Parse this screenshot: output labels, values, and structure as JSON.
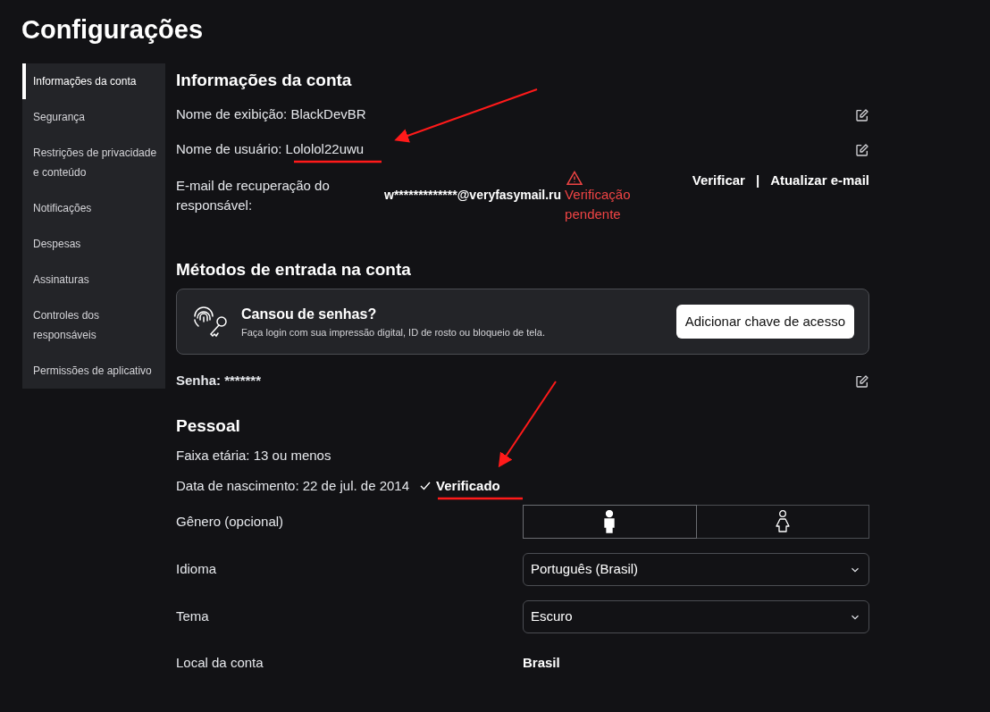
{
  "page_title": "Configurações",
  "sidebar": {
    "items": [
      {
        "label": "Informações da conta",
        "selected": true
      },
      {
        "label": "Segurança",
        "selected": false
      },
      {
        "label": "Restrições de privacidade e conteúdo",
        "selected": false
      },
      {
        "label": "Notificações",
        "selected": false
      },
      {
        "label": "Despesas",
        "selected": false
      },
      {
        "label": "Assinaturas",
        "selected": false
      },
      {
        "label": "Controles dos responsáveis",
        "selected": false
      },
      {
        "label": "Permissões de aplicativo",
        "selected": false
      }
    ]
  },
  "account_info": {
    "heading": "Informações da conta",
    "display_name": {
      "label": "Nome de exibição:",
      "value": "BlackDevBR"
    },
    "username": {
      "label": "Nome de usuário:",
      "value": "Lololol22uwu"
    },
    "recovery_email": {
      "label": "E-mail de recuperação do responsável:",
      "value": "w*************@veryfasymail.ru",
      "status": "Verificação pendente",
      "actions": [
        "Verificar",
        "Atualizar e-mail"
      ],
      "separator": "|"
    }
  },
  "sign_in_methods": {
    "heading": "Métodos de entrada na conta",
    "passkey_card": {
      "title": "Cansou de senhas?",
      "description": "Faça login com sua impressão digital, ID de rosto ou bloqueio de tela.",
      "button": "Adicionar chave de acesso"
    },
    "password": {
      "label": "Senha:",
      "value": "*******"
    }
  },
  "personal": {
    "heading": "Pessoal",
    "age_range": {
      "label": "Faixa etária:",
      "value": "13 ou menos"
    },
    "birth_date": {
      "label": "Data de nascimento:",
      "value": "22 de jul. de 2014",
      "verified": "Verificado"
    },
    "gender": {
      "label": "Gênero (opcional)",
      "options": [
        {
          "kind": "male",
          "selected": true
        },
        {
          "kind": "female",
          "selected": false
        }
      ]
    },
    "language": {
      "label": "Idioma",
      "value": "Português (Brasil)"
    },
    "theme": {
      "label": "Tema",
      "value": "Escuro"
    },
    "location": {
      "label": "Local da conta",
      "value": "Brasil"
    }
  }
}
